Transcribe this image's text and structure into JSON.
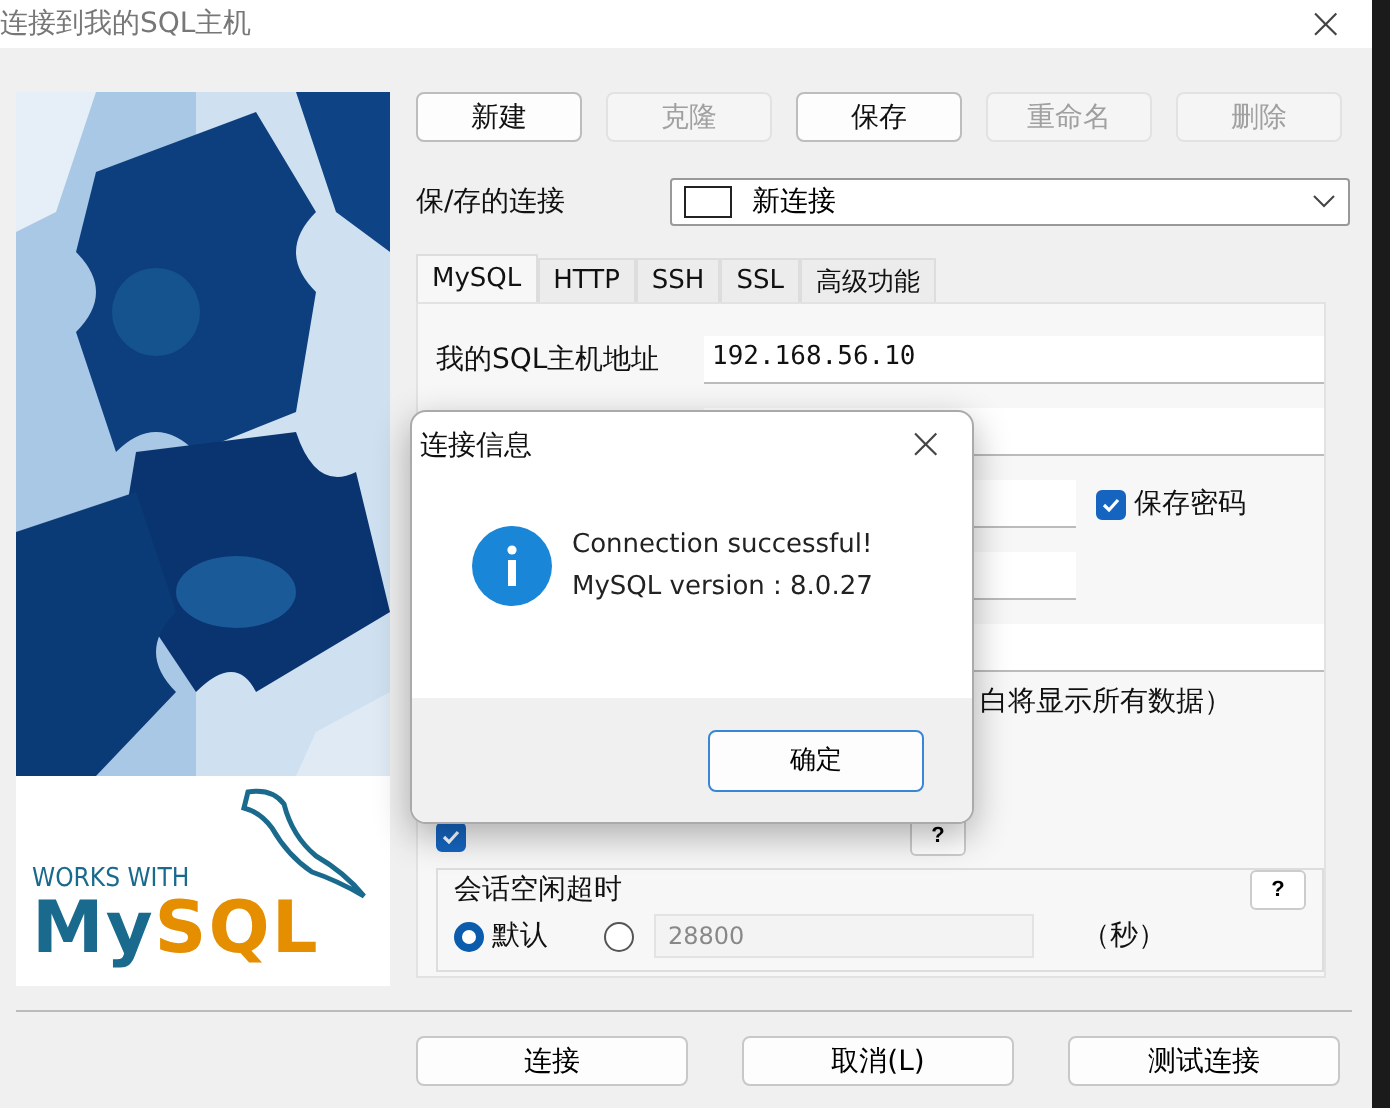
{
  "window": {
    "title": "连接到我的SQL主机",
    "close": "×"
  },
  "toolbar": [
    {
      "label": "新建",
      "disabled": false
    },
    {
      "label": "克隆",
      "disabled": true
    },
    {
      "label": "保存",
      "disabled": false
    },
    {
      "label": "重命名",
      "disabled": true
    },
    {
      "label": "删除",
      "disabled": true
    }
  ],
  "saved_connection": {
    "label": "保/存的连接",
    "value": "新连接"
  },
  "tabs": [
    {
      "label": "MySQL",
      "selected": true
    },
    {
      "label": "HTTP",
      "selected": false
    },
    {
      "label": "SSH",
      "selected": false
    },
    {
      "label": "SSL",
      "selected": false
    },
    {
      "label": "高级功能",
      "selected": false
    }
  ],
  "fields": [
    {
      "kind": "text",
      "label": "我的SQL主机地址",
      "value": "192.168.56.10"
    },
    {
      "kind": "blank"
    },
    {
      "kind": "password",
      "checkbox": {
        "label": "保存密码",
        "checked": true
      }
    },
    {
      "kind": "short"
    },
    {
      "kind": "blank"
    },
    {
      "kind": "note",
      "text": "白将显示所有数据）"
    }
  ],
  "compress": {
    "checked": true,
    "help": "?"
  },
  "timeout": {
    "title": "会话空闲超时",
    "help": "?",
    "options": [
      {
        "label": "默认",
        "selected": true
      },
      {
        "selected": false
      }
    ],
    "value": "28800",
    "unit": "（秒）"
  },
  "logo": {
    "tagline": "WORKS WITH",
    "name_a": "My",
    "name_b": "SQL"
  },
  "footer_buttons": [
    "连接",
    "取消(L)",
    "测试连接"
  ],
  "dialog": {
    "title": "连接信息",
    "close": "×",
    "lines": [
      "Connection successful!",
      "MySQL version : 8.0.27"
    ],
    "button": "确定"
  }
}
